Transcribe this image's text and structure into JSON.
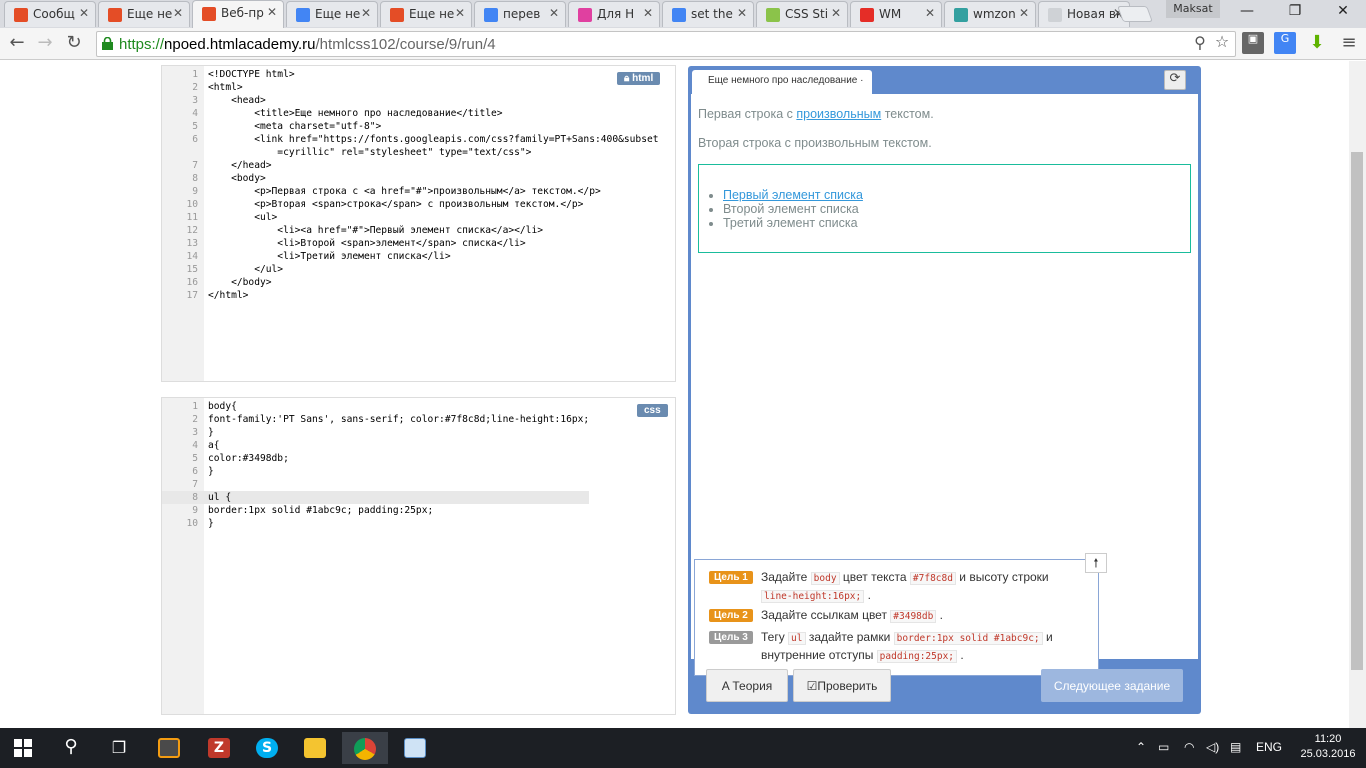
{
  "browser": {
    "tabs": [
      {
        "label": "Сообщ",
        "favicon_color": "#e44d26"
      },
      {
        "label": "Еще не",
        "favicon_color": "#e44d26"
      },
      {
        "label": "Веб-пр",
        "favicon_color": "#e44d26",
        "active": true
      },
      {
        "label": "Еще не",
        "favicon_color": "#4285f4"
      },
      {
        "label": "Еще не",
        "favicon_color": "#e44d26"
      },
      {
        "label": "перев",
        "favicon_color": "#4285f4"
      },
      {
        "label": "Для Н",
        "favicon_color": "#e040a0"
      },
      {
        "label": "set the",
        "favicon_color": "#4285f4"
      },
      {
        "label": "CSS Sti",
        "favicon_color": "#8bc34a"
      },
      {
        "label": "WM",
        "favicon_color": "#e52d27"
      },
      {
        "label": "wmzon",
        "favicon_color": "#33a0a0"
      },
      {
        "label": "Новая вкл",
        "favicon_color": "#cfd2d6"
      }
    ],
    "user": "Maksat",
    "url": {
      "scheme": "https://",
      "host": "npoed.htmlacademy.ru",
      "path": "/htmlcss102/course/9/run/4"
    }
  },
  "html_editor": {
    "badge": "html",
    "lines": [
      "<!DOCTYPE html>",
      "<html>",
      "    <head>",
      "        <title>Еще немного про наследование</title>",
      "        <meta charset=\"utf-8\">",
      "        <link href=\"https://fonts.googleapis.com/css?family=PT+Sans:400&subset",
      "            =cyrillic\" rel=\"stylesheet\" type=\"text/css\">",
      "    </head>",
      "    <body>",
      "        <p>Первая строка с <a href=\"#\">произвольным</a> текстом.</p>",
      "        <p>Вторая <span>строка</span> с произвольным текстом.</p>",
      "        <ul>",
      "            <li><a href=\"#\">Первый элемент списка</a></li>",
      "            <li>Второй <span>элемент</span> списка</li>",
      "            <li>Третий элемент списка</li>",
      "        </ul>",
      "    </body>",
      "</html>"
    ],
    "line_numbers": [
      "1",
      "2",
      "3",
      "4",
      "5",
      "6",
      "",
      "7",
      "8",
      "9",
      "10",
      "11",
      "12",
      "13",
      "14",
      "15",
      "16",
      "17"
    ]
  },
  "css_editor": {
    "badge": "css",
    "lines": [
      "body{",
      "font-family:'PT Sans', sans-serif; color:#7f8c8d;line-height:16px;",
      "}",
      "a{",
      "color:#3498db;",
      "}",
      "",
      "ul {",
      "border:1px solid #1abc9c; padding:25px;",
      "}"
    ],
    "line_numbers": [
      "1",
      "2",
      "3",
      "4",
      "5",
      "6",
      "7",
      "8",
      "9",
      "10"
    ]
  },
  "preview": {
    "tab_title": "Еще немного про наследование",
    "p1_before": "Первая строка с ",
    "p1_link": "произвольным",
    "p1_after": " текстом.",
    "p2": "Вторая строка с произвольным текстом.",
    "list": [
      "Первый элемент списка",
      "Второй элемент списка",
      "Третий элемент списка"
    ],
    "text_color": "#7f8c8d",
    "link_color": "#3498db",
    "border_color": "#1abc9c"
  },
  "goals": [
    {
      "badge": "Цель 1",
      "color": "#e8931a",
      "parts": [
        "Задайте ",
        "body",
        " цвет текста ",
        "#7f8c8d",
        " и высоту строки ",
        "line-height:16px;",
        " ."
      ]
    },
    {
      "badge": "Цель 2",
      "color": "#e8931a",
      "parts": [
        "Задайте ссылкам цвет ",
        "#3498db",
        " ."
      ]
    },
    {
      "badge": "Цель 3",
      "color": "#9a9a9a",
      "parts": [
        "Тегу ",
        "ul",
        " задайте рамки ",
        "border:1px solid #1abc9c;",
        " и внутренние отступы ",
        "padding:25px;",
        " ."
      ]
    }
  ],
  "buttons": {
    "theory": "Теория",
    "check": "Проверить",
    "next": "Следующее задание"
  },
  "taskbar": {
    "time": "11:20",
    "date": "25.03.2016",
    "lang": "ENG"
  }
}
